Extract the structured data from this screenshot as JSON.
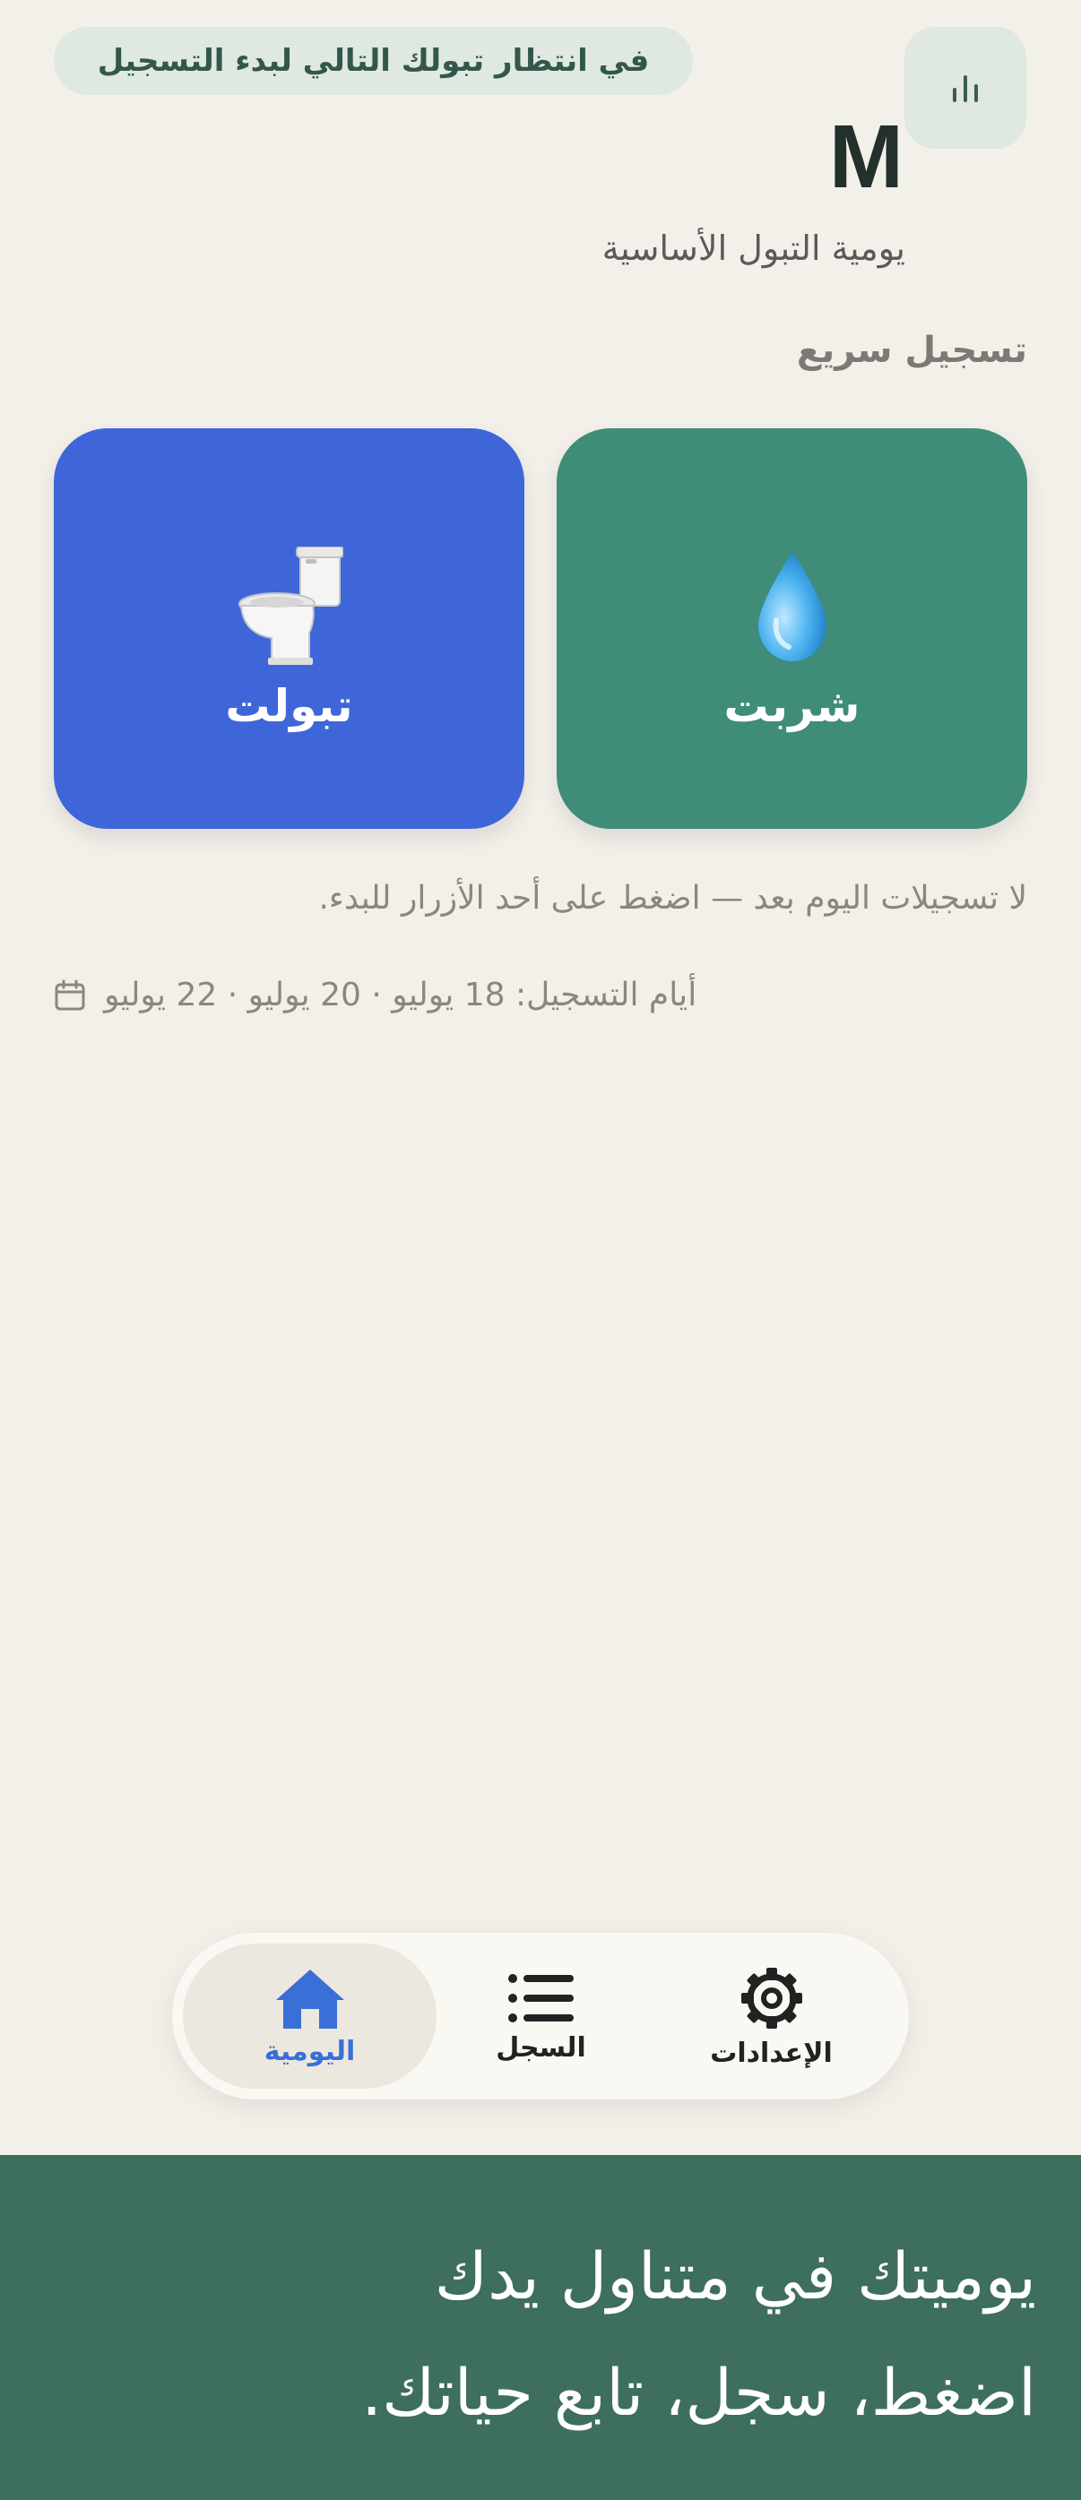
{
  "status_pill": {
    "text": "في انتظار تبولك التالي لبدء التسجيل"
  },
  "header": {
    "logo_letter": "M",
    "subtitle": "يومية التبول الأساسية",
    "stats_icon": "bar-chart-icon"
  },
  "quick_log": {
    "title": "تسجيل سريع",
    "buttons": [
      {
        "label": "شربت",
        "icon": "water-drop-icon",
        "color": "#3f8c78"
      },
      {
        "label": "تبولت",
        "icon": "toilet-icon",
        "color": "#3e66d9"
      }
    ]
  },
  "empty_state": "لا تسجيلات اليوم بعد — اضغط على أحد الأزرار للبدء.",
  "logging_days": {
    "text": "أيام التسجيل: 18 يوليو · 20 يوليو · 22 يوليو",
    "icon": "calendar-icon"
  },
  "nav": {
    "items": [
      {
        "label": "الإعدادات",
        "icon": "gear-icon"
      },
      {
        "label": "السجل",
        "icon": "list-icon"
      },
      {
        "label": "اليومية",
        "icon": "home-icon",
        "active": true
      }
    ],
    "active_color": "#3a6fd8"
  },
  "banner": {
    "line1": "يوميتك في متناول يدك",
    "line2": "اضغط، سجل، تابع حياتك.",
    "background": "#3e6e5c"
  }
}
